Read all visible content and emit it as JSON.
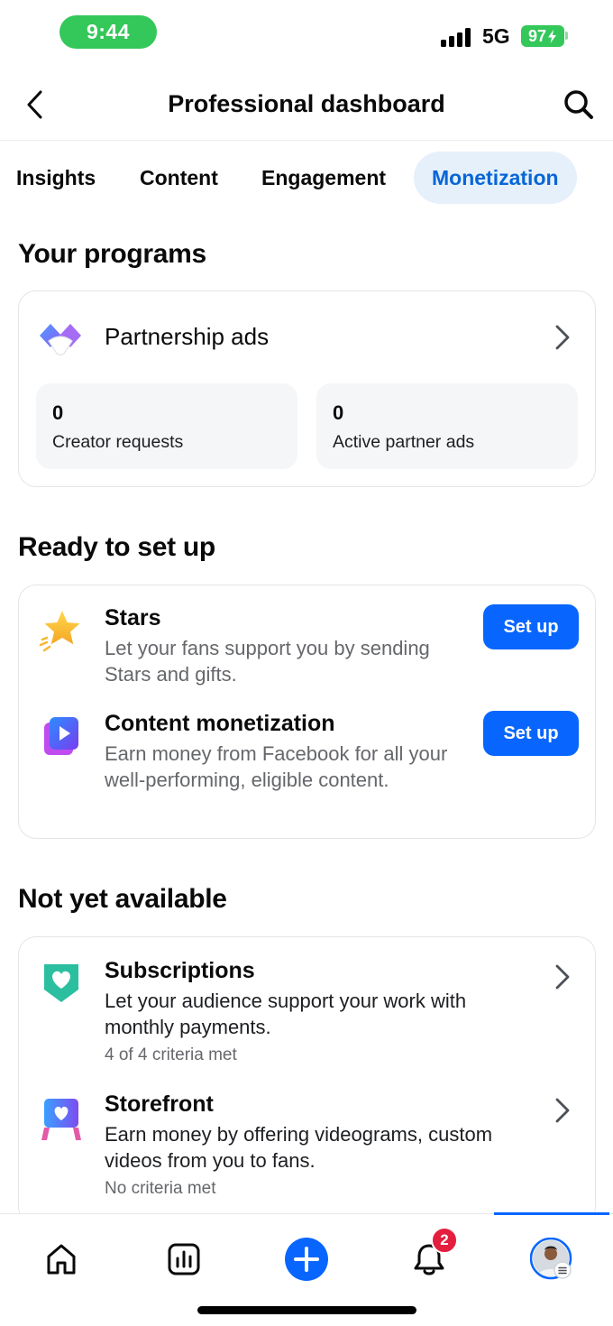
{
  "status": {
    "time": "9:44",
    "network": "5G",
    "battery": "97"
  },
  "header": {
    "title": "Professional dashboard"
  },
  "tabs": [
    {
      "label": "Insights",
      "active": false
    },
    {
      "label": "Content",
      "active": false
    },
    {
      "label": "Engagement",
      "active": false
    },
    {
      "label": "Monetization",
      "active": true
    }
  ],
  "programs": {
    "section_title": "Your programs",
    "partnership": {
      "title": "Partnership ads",
      "stats": [
        {
          "value": "0",
          "label": "Creator requests"
        },
        {
          "value": "0",
          "label": "Active partner ads"
        }
      ]
    }
  },
  "ready": {
    "section_title": "Ready to set up",
    "items": [
      {
        "title": "Stars",
        "description": "Let your fans support you by sending Stars and gifts.",
        "button": "Set up",
        "icon": "star-icon"
      },
      {
        "title": "Content monetization",
        "description": "Earn money from Facebook for all your well-performing, eligible content.",
        "button": "Set up",
        "icon": "play-icon"
      }
    ]
  },
  "not_available": {
    "section_title": "Not yet available",
    "items": [
      {
        "title": "Subscriptions",
        "description": "Let your audience support your work with monthly payments.",
        "meta": "4 of 4 criteria met",
        "icon": "heart-badge-icon"
      },
      {
        "title": "Storefront",
        "description": "Earn money by offering videograms, custom videos from you to fans.",
        "meta": "No criteria met",
        "icon": "storefront-icon"
      }
    ]
  },
  "bottom_nav": {
    "items": [
      "home-icon",
      "insights-chart-icon",
      "create-plus-icon",
      "notifications-bell-icon",
      "profile-avatar"
    ],
    "notification_count": "2",
    "active_index": 4
  },
  "colors": {
    "accent": "#0866ff",
    "active_tab_bg": "#e5f0fb",
    "active_tab_text": "#0866d6",
    "status_green": "#34c759"
  }
}
